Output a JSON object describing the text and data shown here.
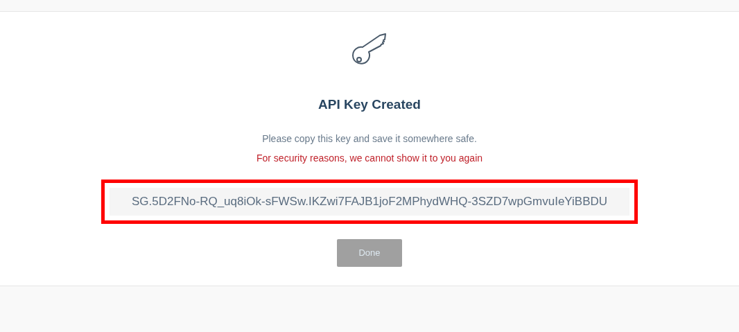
{
  "dialog": {
    "title": "API Key Created",
    "message": "Please copy this key and save it somewhere safe.",
    "warning": "For security reasons, we cannot show it to you again",
    "key_field": {
      "value": "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",
      "highlighted": true
    },
    "done_button": {
      "label": "Done",
      "disabled": true
    }
  }
}
